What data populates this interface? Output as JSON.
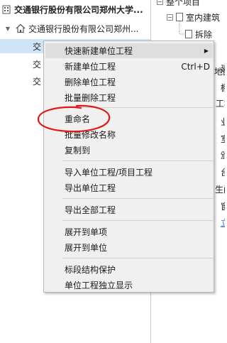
{
  "left_tree": {
    "root_label": "交通银行股份有限公司郑州大学...",
    "child_label": "交通银行股份有限公司郑州...",
    "rows": [
      "交",
      "交",
      "交"
    ]
  },
  "right_tree": {
    "top_label": "整个项目",
    "node1": "室内建筑",
    "node2": "拆除",
    "items": [
      "建",
      "地面",
      "棚",
      "工程",
      "业",
      "室",
      "颁",
      "台",
      "生间",
      "窗",
      "立"
    ]
  },
  "menu": {
    "items": [
      {
        "label": "快速新建单位工程",
        "shortcut": "",
        "submenu": true
      },
      {
        "label": "新建单位工程",
        "shortcut": "Ctrl+D"
      },
      {
        "label": "删除单位工程",
        "shortcut": ""
      },
      {
        "label": "批量删除工程",
        "shortcut": ""
      },
      {
        "label": "重命名",
        "shortcut": ""
      },
      {
        "label": "批量修改名称",
        "shortcut": ""
      },
      {
        "label": "复制到",
        "shortcut": ""
      },
      {
        "label": "导入单位工程/项目工程",
        "shortcut": ""
      },
      {
        "label": "导出单位工程",
        "shortcut": ""
      },
      {
        "label": "导出全部工程",
        "shortcut": ""
      },
      {
        "label": "展开到单项",
        "shortcut": ""
      },
      {
        "label": "展开到单位",
        "shortcut": ""
      },
      {
        "label": "标段结构保护",
        "shortcut": ""
      },
      {
        "label": "单位工程独立显示",
        "shortcut": ""
      }
    ]
  },
  "annotation_color": "#e01818"
}
